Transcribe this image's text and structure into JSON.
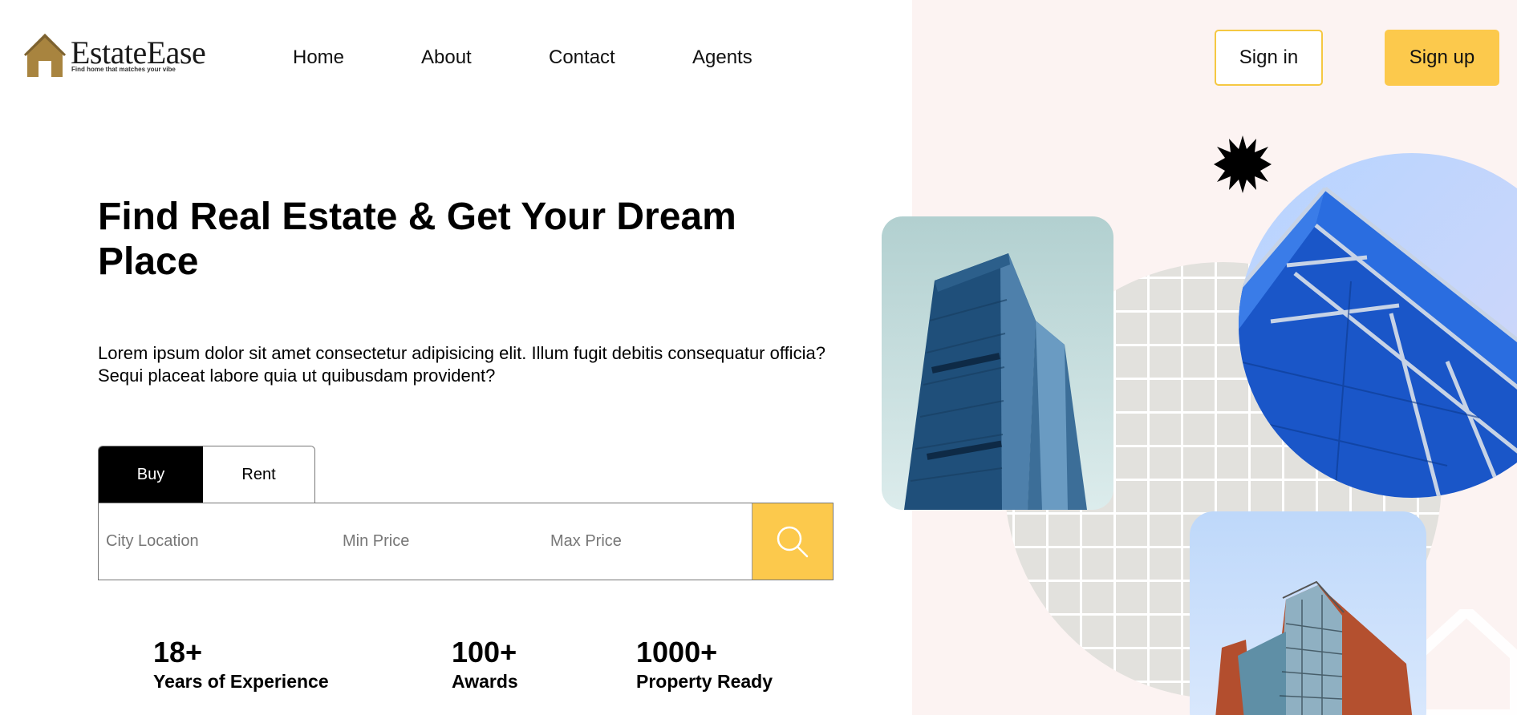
{
  "brand": {
    "name": "EstateEase",
    "tagline": "Find home that matches your vibe",
    "accent_color": "#fcc94c",
    "logo_color": "#a8843f"
  },
  "nav": {
    "items": [
      {
        "label": "Home"
      },
      {
        "label": "About"
      },
      {
        "label": "Contact"
      },
      {
        "label": "Agents"
      }
    ],
    "signin_label": "Sign in",
    "signup_label": "Sign up"
  },
  "hero": {
    "title": "Find Real Estate & Get Your Dream Place",
    "description": "Lorem ipsum dolor sit amet consectetur adipisicing elit. Illum fugit debitis consequatur officia? Sequi placeat labore quia ut quibusdam provident?"
  },
  "search": {
    "tabs": [
      {
        "label": "Buy",
        "active": true
      },
      {
        "label": "Rent",
        "active": false
      }
    ],
    "city_placeholder": "City Location",
    "min_price_placeholder": "Min Price",
    "max_price_placeholder": "Max Price",
    "button_icon": "search-icon"
  },
  "stats": [
    {
      "number": "18+",
      "label": "Years of Experience"
    },
    {
      "number": "100+",
      "label": "Awards"
    },
    {
      "number": "1000+",
      "label": "Property Ready"
    }
  ],
  "decor": {
    "background_color": "#fcf3f2",
    "star_icon": "starburst-icon"
  }
}
